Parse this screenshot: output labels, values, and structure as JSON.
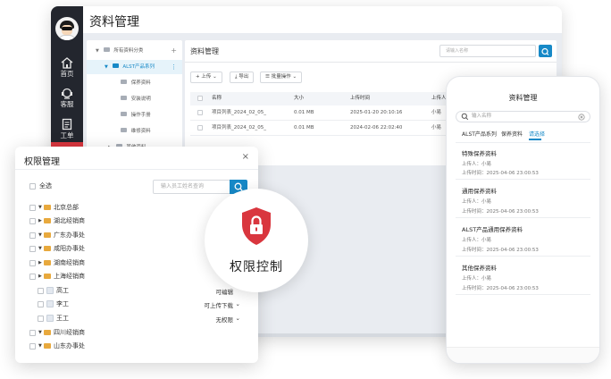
{
  "desktop": {
    "title": "资料管理",
    "nav": [
      {
        "label": "首页",
        "icon": "home-icon"
      },
      {
        "label": "客服",
        "icon": "headset-icon"
      },
      {
        "label": "工单",
        "icon": "clipboard-icon"
      }
    ],
    "tree": {
      "root": "所有资料分类",
      "add_symbol": "+",
      "selected": "ALST产品系列",
      "menu_symbol": "⋮",
      "children": [
        "保养资料",
        "安装说明",
        "操作手册",
        "维修资料"
      ],
      "other": "其他资料"
    },
    "panel": {
      "title": "资料管理",
      "search_placeholder": "请输入名称",
      "upload": "上传",
      "export": "导出",
      "batch": "批量操作",
      "columns": [
        "名称",
        "大小",
        "上传时间",
        "上传人"
      ],
      "rows": [
        {
          "name": "项目列表_2024_02_05_",
          "size": "0.01 MB",
          "time": "2025-01-20 20:10:16",
          "user": "小易"
        },
        {
          "name": "项目列表_2024_02_05_",
          "size": "0.01 MB",
          "time": "2024-02-06 22:02:40",
          "user": "小易"
        }
      ]
    }
  },
  "permission": {
    "title": "权限管理",
    "close": "×",
    "select_all": "全选",
    "search_placeholder": "输入员工姓名查询",
    "nodes": [
      {
        "label": "北京总部",
        "type": "folder",
        "expanded": true
      },
      {
        "label": "湖北经销商",
        "type": "folder",
        "expanded": false
      },
      {
        "label": "广东办事处",
        "type": "folder",
        "expanded": true
      },
      {
        "label": "咸阳办事处",
        "type": "folder",
        "expanded": true
      },
      {
        "label": "湖南经销商",
        "type": "folder",
        "expanded": false
      },
      {
        "label": "上海经销商",
        "type": "folder",
        "expanded": false
      },
      {
        "label": "高工",
        "type": "person",
        "permission": "可编辑"
      },
      {
        "label": "李工",
        "type": "person",
        "permission": "可上传下载"
      },
      {
        "label": "王工",
        "type": "person",
        "permission": "无权限"
      },
      {
        "label": "四川经销商",
        "type": "folder",
        "expanded": true
      },
      {
        "label": "山东办事处",
        "type": "folder",
        "expanded": true
      }
    ]
  },
  "badge": {
    "text": "权限控制",
    "icon": "lock-shield-icon"
  },
  "mobile": {
    "title": "资料管理",
    "search_placeholder": "输入名称",
    "tabs": [
      "ALST产品系列",
      "保养资料",
      "请选择"
    ],
    "active_tab": 2,
    "uploader_label": "上传人：",
    "time_label": "上传时间：",
    "items": [
      {
        "title": "特殊保养资料",
        "uploader": "小易",
        "time": "2025-04-06 23:00:53"
      },
      {
        "title": "通用保养资料",
        "uploader": "小易",
        "time": "2025-04-06 23:00:53"
      },
      {
        "title": "ALST产品通用保养资料",
        "uploader": "小易",
        "time": "2025-04-06 23:00:53"
      },
      {
        "title": "其他保养资料",
        "uploader": "小易",
        "time": "2025-04-06 23:00:53"
      }
    ]
  },
  "colors": {
    "accent": "#1789c7",
    "danger": "#d9363e",
    "sidebar": "#23262e",
    "folder": "#e8a93d"
  }
}
